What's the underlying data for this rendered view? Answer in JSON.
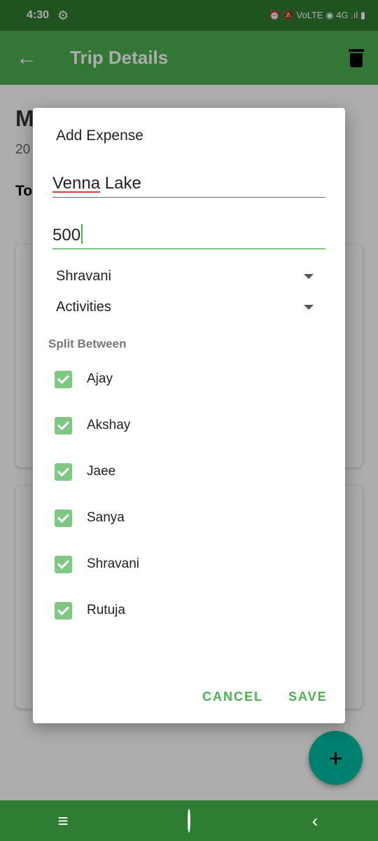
{
  "status": {
    "time": "4:30",
    "settings_icon": "gear-icon",
    "indicators": "⏰ 🔕 VoLTE ◉ 4G .ıl ▮"
  },
  "appbar": {
    "back_icon": "arrow-left-icon",
    "title": "Trip Details",
    "delete_icon": "trash-icon"
  },
  "background": {
    "trip_name": "M",
    "trip_date": "20",
    "total_label": "To"
  },
  "dialog": {
    "title": "Add Expense",
    "name_part1": "Venna",
    "name_part2": " Lake",
    "amount": "500",
    "paid_by": "Shravani",
    "category": "Activities",
    "split_label": "Split Between",
    "members": [
      {
        "name": "Ajay",
        "checked": true
      },
      {
        "name": "Akshay",
        "checked": true
      },
      {
        "name": "Jaee",
        "checked": true
      },
      {
        "name": "Sanya",
        "checked": true
      },
      {
        "name": "Shravani",
        "checked": true
      },
      {
        "name": "Rutuja",
        "checked": true
      }
    ],
    "cancel_label": "CANCEL",
    "save_label": "SAVE"
  },
  "fab": {
    "label": "+"
  },
  "navbar": {
    "menu_icon": "≡",
    "back_icon": "‹"
  },
  "colors": {
    "status_bar": "#2e7d32",
    "app_bar": "#4caf50",
    "accent": "#4caf50",
    "checkbox": "#81c784",
    "fab": "#00bfa5"
  }
}
